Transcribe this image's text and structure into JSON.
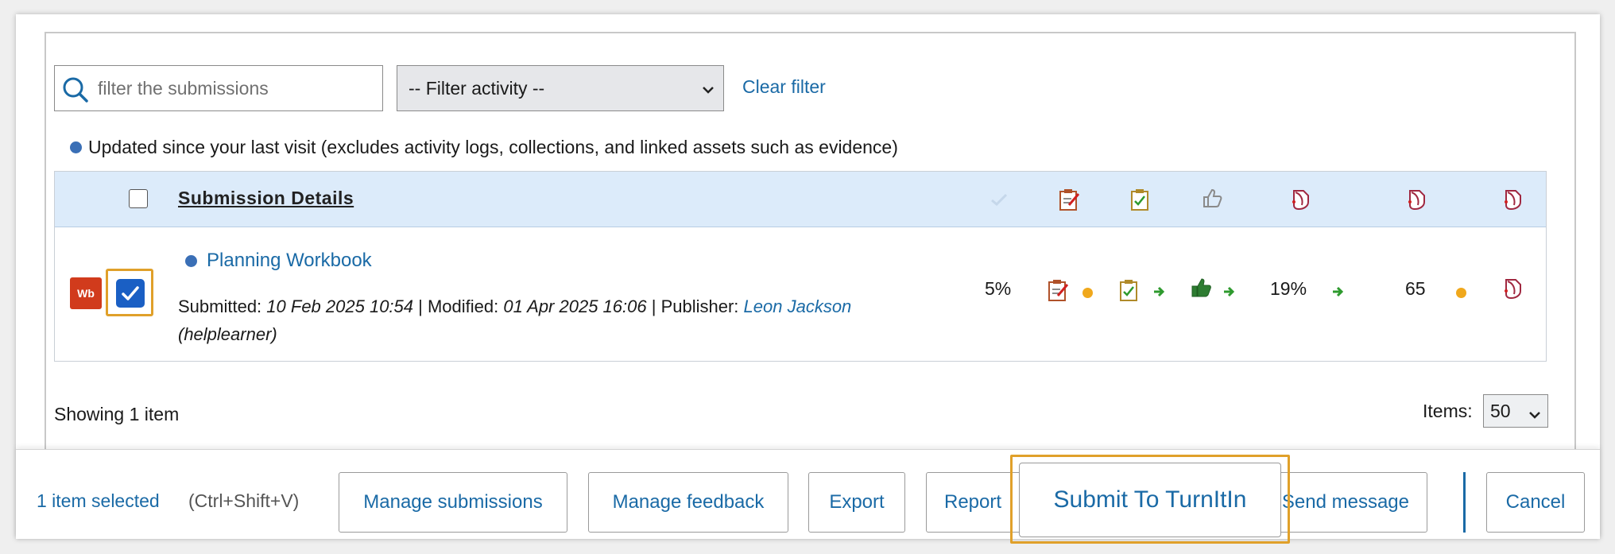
{
  "filters": {
    "search_placeholder": "filter the submissions",
    "activity_select": "-- Filter activity --",
    "clear_filter": "Clear filter"
  },
  "legend_note": "Updated since your last visit (excludes activity logs, collections, and linked assets such as evidence)",
  "table": {
    "header_title": "Submission Details",
    "column_icons": [
      "check-faded-icon",
      "clipboard-edit-icon",
      "clipboard-check-icon",
      "thumbs-up-outline-icon",
      "turnitin-icon",
      "turnitin-icon",
      "turnitin-icon"
    ],
    "rows": [
      {
        "badge": "Wb",
        "selected": true,
        "title": "Planning Workbook",
        "submitted_label": "Submitted:",
        "submitted_value": "10 Feb 2025 10:54",
        "modified_label": "Modified:",
        "modified_value": "01 Apr 2025 16:06",
        "publisher_label": "Publisher:",
        "publisher_name": "Leon Jackson",
        "publisher_user": "(helplearner)",
        "progress": "5%",
        "similarity": "19%",
        "score": "65"
      }
    ]
  },
  "pagination": {
    "showing": "Showing 1 item",
    "items_label": "Items:",
    "items_value": "50"
  },
  "footer": {
    "selected_count": "1 item selected",
    "shortcut": "(Ctrl+Shift+V)",
    "buttons": {
      "manage_submissions": "Manage submissions",
      "manage_feedback": "Manage feedback",
      "export": "Export",
      "report": "Report",
      "submit_turnitin": "Submit To TurnItIn",
      "send_message": "Send message",
      "cancel": "Cancel"
    }
  },
  "colors": {
    "link_blue": "#1a6aa6",
    "header_bg": "#dcebfa",
    "highlight_orange": "#e0a02a",
    "badge_red": "#d13b1c",
    "warn_amber": "#f0a81c",
    "ok_green": "#2e9a2e"
  }
}
